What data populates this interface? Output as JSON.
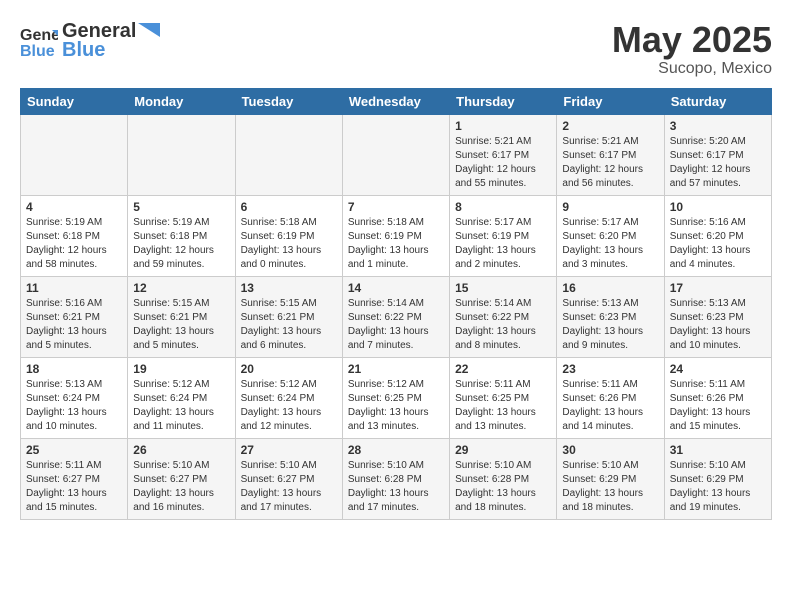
{
  "header": {
    "logo_general": "General",
    "logo_blue": "Blue",
    "title": "May 2025",
    "subtitle": "Sucopo, Mexico"
  },
  "weekdays": [
    "Sunday",
    "Monday",
    "Tuesday",
    "Wednesday",
    "Thursday",
    "Friday",
    "Saturday"
  ],
  "weeks": [
    [
      {
        "day": "",
        "info": ""
      },
      {
        "day": "",
        "info": ""
      },
      {
        "day": "",
        "info": ""
      },
      {
        "day": "",
        "info": ""
      },
      {
        "day": "1",
        "info": "Sunrise: 5:21 AM\nSunset: 6:17 PM\nDaylight: 12 hours\nand 55 minutes."
      },
      {
        "day": "2",
        "info": "Sunrise: 5:21 AM\nSunset: 6:17 PM\nDaylight: 12 hours\nand 56 minutes."
      },
      {
        "day": "3",
        "info": "Sunrise: 5:20 AM\nSunset: 6:17 PM\nDaylight: 12 hours\nand 57 minutes."
      }
    ],
    [
      {
        "day": "4",
        "info": "Sunrise: 5:19 AM\nSunset: 6:18 PM\nDaylight: 12 hours\nand 58 minutes."
      },
      {
        "day": "5",
        "info": "Sunrise: 5:19 AM\nSunset: 6:18 PM\nDaylight: 12 hours\nand 59 minutes."
      },
      {
        "day": "6",
        "info": "Sunrise: 5:18 AM\nSunset: 6:19 PM\nDaylight: 13 hours\nand 0 minutes."
      },
      {
        "day": "7",
        "info": "Sunrise: 5:18 AM\nSunset: 6:19 PM\nDaylight: 13 hours\nand 1 minute."
      },
      {
        "day": "8",
        "info": "Sunrise: 5:17 AM\nSunset: 6:19 PM\nDaylight: 13 hours\nand 2 minutes."
      },
      {
        "day": "9",
        "info": "Sunrise: 5:17 AM\nSunset: 6:20 PM\nDaylight: 13 hours\nand 3 minutes."
      },
      {
        "day": "10",
        "info": "Sunrise: 5:16 AM\nSunset: 6:20 PM\nDaylight: 13 hours\nand 4 minutes."
      }
    ],
    [
      {
        "day": "11",
        "info": "Sunrise: 5:16 AM\nSunset: 6:21 PM\nDaylight: 13 hours\nand 5 minutes."
      },
      {
        "day": "12",
        "info": "Sunrise: 5:15 AM\nSunset: 6:21 PM\nDaylight: 13 hours\nand 5 minutes."
      },
      {
        "day": "13",
        "info": "Sunrise: 5:15 AM\nSunset: 6:21 PM\nDaylight: 13 hours\nand 6 minutes."
      },
      {
        "day": "14",
        "info": "Sunrise: 5:14 AM\nSunset: 6:22 PM\nDaylight: 13 hours\nand 7 minutes."
      },
      {
        "day": "15",
        "info": "Sunrise: 5:14 AM\nSunset: 6:22 PM\nDaylight: 13 hours\nand 8 minutes."
      },
      {
        "day": "16",
        "info": "Sunrise: 5:13 AM\nSunset: 6:23 PM\nDaylight: 13 hours\nand 9 minutes."
      },
      {
        "day": "17",
        "info": "Sunrise: 5:13 AM\nSunset: 6:23 PM\nDaylight: 13 hours\nand 10 minutes."
      }
    ],
    [
      {
        "day": "18",
        "info": "Sunrise: 5:13 AM\nSunset: 6:24 PM\nDaylight: 13 hours\nand 10 minutes."
      },
      {
        "day": "19",
        "info": "Sunrise: 5:12 AM\nSunset: 6:24 PM\nDaylight: 13 hours\nand 11 minutes."
      },
      {
        "day": "20",
        "info": "Sunrise: 5:12 AM\nSunset: 6:24 PM\nDaylight: 13 hours\nand 12 minutes."
      },
      {
        "day": "21",
        "info": "Sunrise: 5:12 AM\nSunset: 6:25 PM\nDaylight: 13 hours\nand 13 minutes."
      },
      {
        "day": "22",
        "info": "Sunrise: 5:11 AM\nSunset: 6:25 PM\nDaylight: 13 hours\nand 13 minutes."
      },
      {
        "day": "23",
        "info": "Sunrise: 5:11 AM\nSunset: 6:26 PM\nDaylight: 13 hours\nand 14 minutes."
      },
      {
        "day": "24",
        "info": "Sunrise: 5:11 AM\nSunset: 6:26 PM\nDaylight: 13 hours\nand 15 minutes."
      }
    ],
    [
      {
        "day": "25",
        "info": "Sunrise: 5:11 AM\nSunset: 6:27 PM\nDaylight: 13 hours\nand 15 minutes."
      },
      {
        "day": "26",
        "info": "Sunrise: 5:10 AM\nSunset: 6:27 PM\nDaylight: 13 hours\nand 16 minutes."
      },
      {
        "day": "27",
        "info": "Sunrise: 5:10 AM\nSunset: 6:27 PM\nDaylight: 13 hours\nand 17 minutes."
      },
      {
        "day": "28",
        "info": "Sunrise: 5:10 AM\nSunset: 6:28 PM\nDaylight: 13 hours\nand 17 minutes."
      },
      {
        "day": "29",
        "info": "Sunrise: 5:10 AM\nSunset: 6:28 PM\nDaylight: 13 hours\nand 18 minutes."
      },
      {
        "day": "30",
        "info": "Sunrise: 5:10 AM\nSunset: 6:29 PM\nDaylight: 13 hours\nand 18 minutes."
      },
      {
        "day": "31",
        "info": "Sunrise: 5:10 AM\nSunset: 6:29 PM\nDaylight: 13 hours\nand 19 minutes."
      }
    ]
  ]
}
